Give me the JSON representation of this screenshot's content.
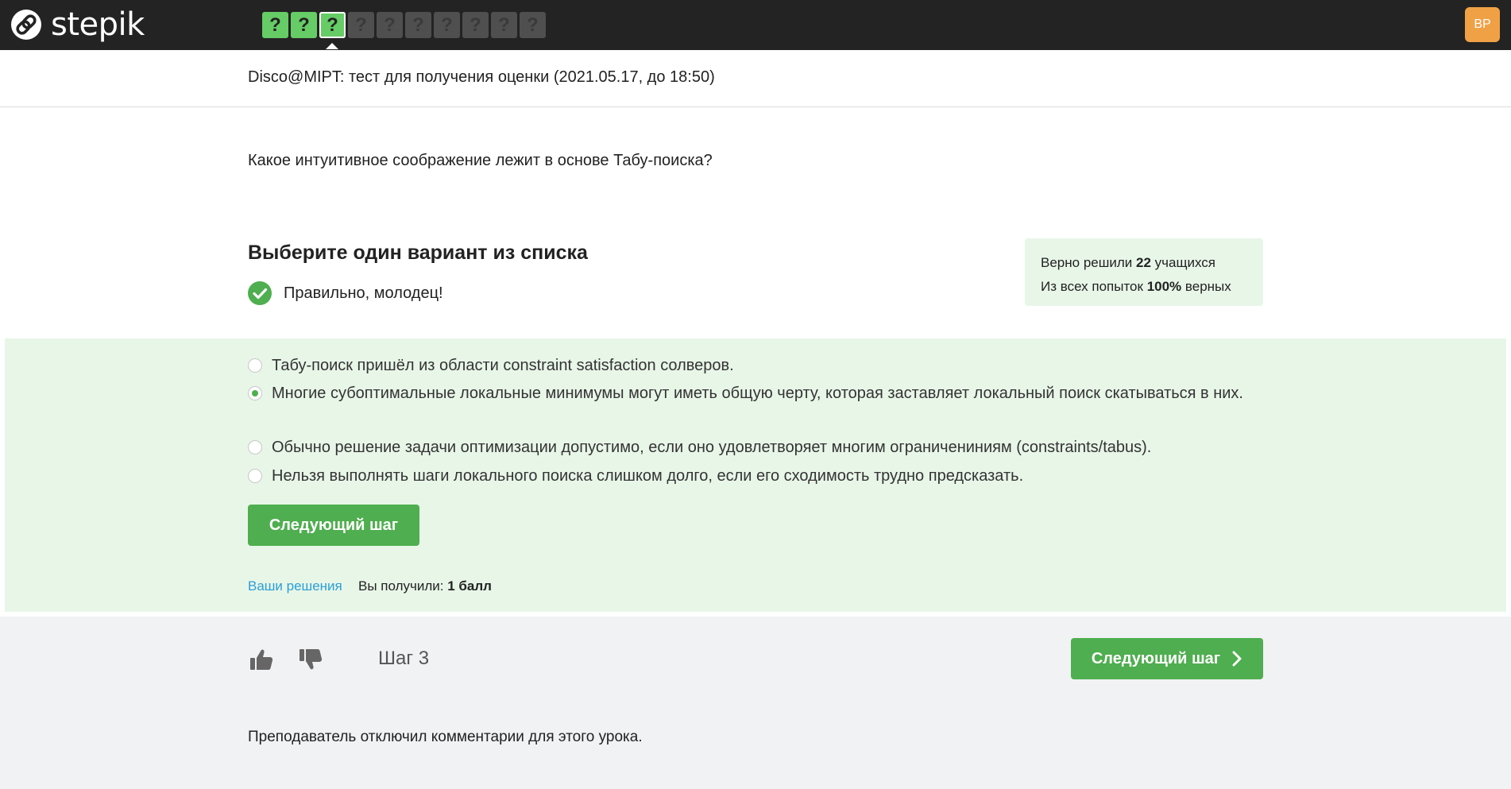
{
  "topbar": {
    "logo_text": "stepik",
    "steps": [
      {
        "label": "?",
        "state": "done"
      },
      {
        "label": "?",
        "state": "done"
      },
      {
        "label": "?",
        "state": "current"
      },
      {
        "label": "?",
        "state": "todo"
      },
      {
        "label": "?",
        "state": "todo"
      },
      {
        "label": "?",
        "state": "todo"
      },
      {
        "label": "?",
        "state": "todo"
      },
      {
        "label": "?",
        "state": "todo"
      },
      {
        "label": "?",
        "state": "todo"
      },
      {
        "label": "?",
        "state": "todo"
      }
    ],
    "avatar_initials": "BP"
  },
  "lesson": {
    "title": "Disco@MIPT: тест для получения оценки (2021.05.17, до 18:50)"
  },
  "question": {
    "text": "Какое интуитивное соображение лежит в основе Табу-поиска?",
    "heading": "Выберите один вариант из списка",
    "result_text": "Правильно, молодец!",
    "stats": {
      "solved_prefix": "Верно решили",
      "solved_count": "22",
      "solved_suffix": "учащихся",
      "attempts_prefix": "Из всех попыток",
      "attempts_percent": "100%",
      "attempts_suffix": "верных"
    },
    "options": [
      {
        "text": "Табу-поиск пришёл из области constraint satisfaction солверов.",
        "selected": false
      },
      {
        "text": "Многие субоптимальные локальные минимумы могут иметь общую черту, которая заставляет локальный поиск скатываться в них.",
        "selected": true
      },
      {
        "text": "Обычно решение задачи оптимизации допустимо, если оно удовлетворяет многим ограничениниям (constraints/tabus).",
        "selected": false
      },
      {
        "text": "Нельзя выполнять шаги локального поиска слишком долго, если его сходимость трудно предсказать.",
        "selected": false
      }
    ],
    "next_button_label": "Следующий шаг",
    "solutions_link": "Ваши решения",
    "score_prefix": "Вы получили:",
    "score_value": "1 балл"
  },
  "footer": {
    "step_label": "Шаг 3",
    "next_button_label": "Следующий шаг",
    "comments_off_text": "Преподаватель отключил комментарии для этого урока."
  },
  "colors": {
    "topbar_bg": "#232323",
    "accent_green": "#4fae4f",
    "step_done": "#66cc66",
    "step_todo": "#4f4f4f",
    "success_bg": "#e8f6e8",
    "avatar_bg": "#f0a145",
    "link_blue": "#2a9fd6"
  },
  "icons": [
    "stepik-logo-icon",
    "check-circle-icon",
    "radio-icon",
    "thumbs-up-icon",
    "thumbs-down-icon",
    "chevron-right-icon"
  ]
}
